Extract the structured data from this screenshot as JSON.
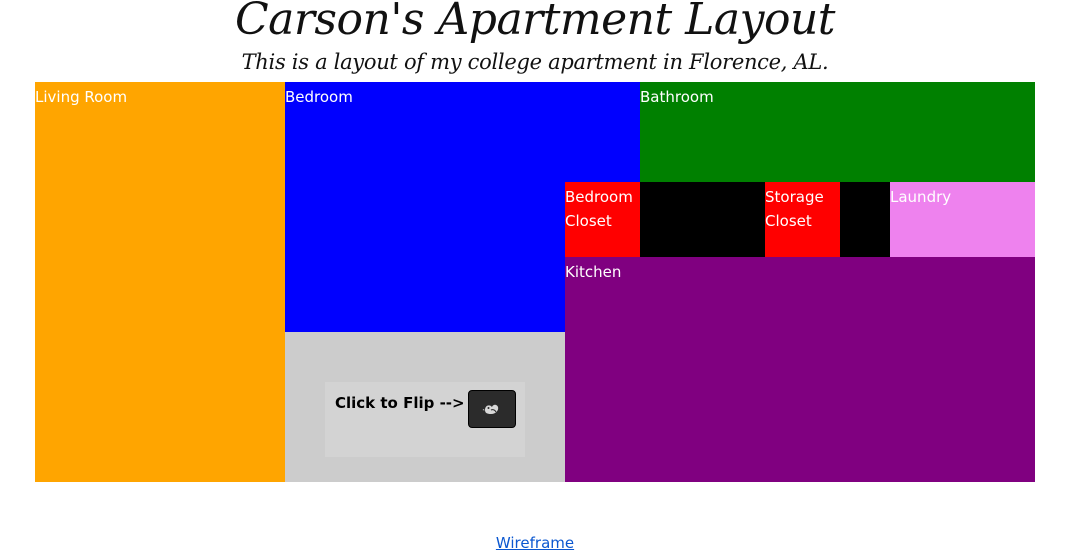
{
  "header": {
    "title": "Carson's Apartment Layout",
    "subtitle": "This is a layout of my college apartment in Florence, AL."
  },
  "rooms": {
    "living_room": {
      "label": "Living Room",
      "color": "#ffa500"
    },
    "bedroom": {
      "label": "Bedroom",
      "color": "#0000ff"
    },
    "bathroom": {
      "label": "Bathroom",
      "color": "#008000"
    },
    "bedroom_closet": {
      "label": "Bedroom\nCloset",
      "color": "#ff0000"
    },
    "storage_closet": {
      "label": "Storage\nCloset",
      "color": "#ff0000"
    },
    "laundry": {
      "label": "Laundry",
      "color": "#ee82ee"
    },
    "kitchen": {
      "label": "Kitchen",
      "color": "#800080"
    },
    "walls": {
      "color": "#000000"
    }
  },
  "flip": {
    "label": "Click to Flip -->",
    "button_icon": "bird-icon",
    "button_color": "#2b2b2b"
  },
  "footer": {
    "link_text": "Wireframe"
  }
}
